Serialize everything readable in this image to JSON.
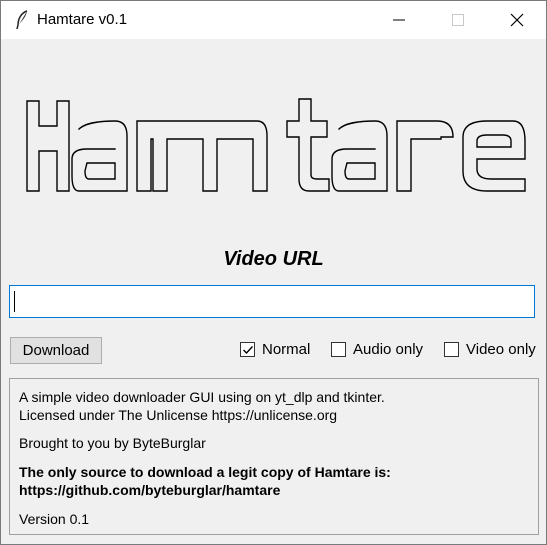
{
  "window": {
    "title": "Hamtare v0.1",
    "icons": [
      "feather-icon",
      "minimize-icon",
      "maximize-icon",
      "close-icon"
    ]
  },
  "banner": {
    "ascii_lines": [
      " _   _                 _                   ",
      "| | | | __ _ _ __ ___ | |_ __ _ _ __ ___   ",
      "| |_| |/ _` | '_ ` _ \\| __/ _` | '__/ _ \\  ",
      "|  _  | (_| | | | | | | || (_| | | |  __/  ",
      "|_| |_|\\__,_|_| |_| |_|\\__\\__,_|_|  \\___|  "
    ]
  },
  "url": {
    "label": "Video URL",
    "value": ""
  },
  "actions": {
    "download_label": "Download"
  },
  "options": {
    "normal": {
      "label": "Normal",
      "checked": true
    },
    "audio_only": {
      "label": "Audio only",
      "checked": false
    },
    "video_only": {
      "label": "Video only",
      "checked": false
    }
  },
  "info": {
    "line1": "A simple video downloader GUI using on yt_dlp and tkinter.",
    "line2": "Licensed under The Unlicense https://unlicense.org",
    "line3": "Brought to you by ByteBurglar",
    "line4": "The only source to download a legit copy of Hamtare is:",
    "line5": "https://github.com/byteburglar/hamtare",
    "line6": "Version 0.1"
  }
}
